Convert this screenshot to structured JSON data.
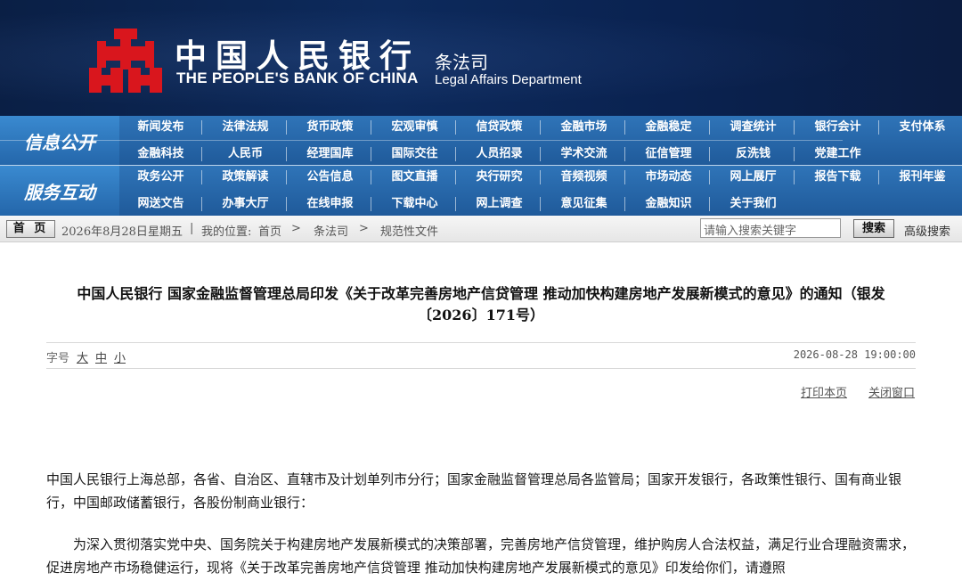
{
  "header": {
    "bank_name_cn": "中国人民银行",
    "bank_name_en": "THE PEOPLE'S BANK OF CHINA",
    "dept_cn": "条法司",
    "dept_en": "Legal Affairs Department",
    "logo_color": "#d9161d",
    "background": "#0d2a5c"
  },
  "nav": {
    "section1_label": "信息公开",
    "section1_items": [
      "新闻发布",
      "法律法规",
      "货币政策",
      "宏观审慎",
      "信贷政策",
      "金融市场",
      "金融稳定",
      "调查统计",
      "银行会计",
      "支付体系",
      "金融科技",
      "人民币",
      "经理国库",
      "国际交往",
      "人员招录",
      "学术交流",
      "征信管理",
      "反洗钱",
      "党建工作"
    ],
    "section2_label": "服务互动",
    "section2_items": [
      "政务公开",
      "政策解读",
      "公告信息",
      "图文直播",
      "央行研究",
      "音频视频",
      "市场动态",
      "网上展厅",
      "报告下载",
      "报刊年鉴",
      "网送文告",
      "办事大厅",
      "在线申报",
      "下载中心",
      "网上调查",
      "意见征集",
      "金融知识",
      "关于我们"
    ]
  },
  "breadcrumb": {
    "home_button": "首 页",
    "date": "2026年8月28日",
    "weekday": "星期五",
    "location_label": "我的位置:",
    "path": [
      "首页",
      "条法司",
      "规范性文件"
    ],
    "search_placeholder": "请输入搜索关键字",
    "search_button": "搜索",
    "advanced_search": "高级搜索"
  },
  "article": {
    "title_line1": "中国人民银行  国家金融监督管理总局印发《关于改革完善房地产信贷管理  推动加快构建房地产发展新模式的意见》的通知（银发",
    "title_line2": "〔2026〕171号）",
    "font_size_label": "字号",
    "font_size_options": [
      "大",
      "中",
      "小"
    ],
    "publish_time": "2026-08-28 19:00:00",
    "print_link": "打印本页",
    "close_link": "关闭窗口",
    "paragraph1": "中国人民银行上海总部，各省、自治区、直辖市及计划单列市分行；国家金融监督管理总局各监管局；国家开发银行，各政策性银行、国有商业银行，中国邮政储蓄银行，各股份制商业银行：",
    "paragraph2": "为深入贯彻落实党中央、国务院关于构建房地产发展新模式的决策部署，完善房地产信贷管理，维护购房人合法权益，满足行业合理融资需求，促进房地产市场稳健运行，现将《关于改革完善房地产信贷管理  推动加快构建房地产发展新模式的意见》印发给你们，请遵照"
  }
}
